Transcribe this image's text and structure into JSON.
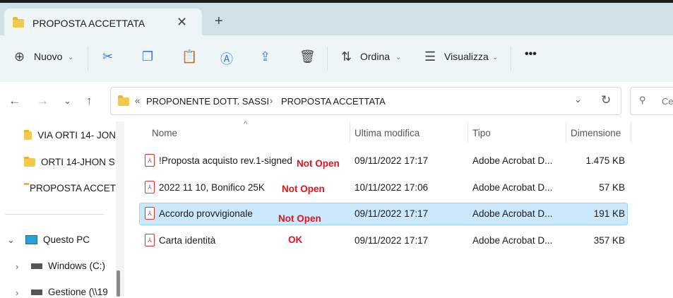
{
  "tab": {
    "title": "PROPOSTA ACCETTATA"
  },
  "toolbar": {
    "new_label": "Nuovo",
    "sort_label": "Ordina",
    "view_label": "Visualizza"
  },
  "address": {
    "breadcrumb": [
      "PROPONENTE DOTT. SASSI",
      "PROPOSTA ACCETTATA"
    ],
    "search_placeholder": "Ce"
  },
  "sidebar": {
    "items": [
      "VIA ORTI 14- JON",
      "ORTI 14-JHON S",
      "PROPOSTA ACCETTATA"
    ],
    "this_pc": "Questo PC",
    "drives": [
      "Windows (C:)",
      "Gestione (\\\\19"
    ]
  },
  "columns": [
    "Nome",
    "Ultima modifica",
    "Tipo",
    "Dimensione"
  ],
  "files": [
    {
      "name": "!Proposta acquisto rev.1-signed",
      "modified": "09/11/2022 17:17",
      "type": "Adobe Acrobat D...",
      "size": "1.475 KB",
      "note": "Not Open"
    },
    {
      "name": "2022 11 10, Bonifico 25K",
      "modified": "10/11/2022 17:06",
      "type": "Adobe Acrobat D...",
      "size": "57 KB",
      "note": "Not Open"
    },
    {
      "name": "Accordo provvigionale",
      "modified": "09/11/2022 17:17",
      "type": "Adobe Acrobat D...",
      "size": "191 KB",
      "note": "Not Open"
    },
    {
      "name": "Carta identità",
      "modified": "09/11/2022 17:17",
      "type": "Adobe Acrobat D...",
      "size": "357 KB",
      "note": "OK"
    }
  ]
}
